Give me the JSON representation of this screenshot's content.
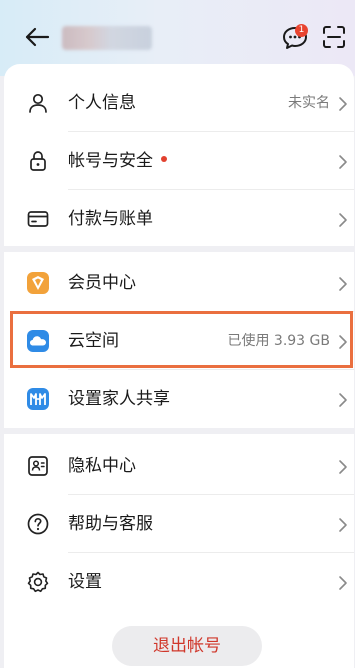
{
  "header": {
    "back_icon": "arrow-left-icon",
    "message_icon": "chat-bubble-icon",
    "message_badge": "1",
    "scan_icon": "scan-icon"
  },
  "groups": [
    {
      "items": [
        {
          "icon": "person-icon",
          "label": "个人信息",
          "value": "未实名"
        },
        {
          "icon": "lock-icon",
          "label": "帐号与安全",
          "value": "",
          "alert_dot": true
        },
        {
          "icon": "card-icon",
          "label": "付款与账单",
          "value": ""
        }
      ]
    },
    {
      "items": [
        {
          "icon": "member-shield-icon",
          "label": "会员中心",
          "value": ""
        },
        {
          "icon": "cloud-icon",
          "label": "云空间",
          "value": "已使用 3.93 GB"
        },
        {
          "icon": "family-share-icon",
          "label": "设置家人共享",
          "value": ""
        }
      ]
    },
    {
      "items": [
        {
          "icon": "privacy-icon",
          "label": "隐私中心",
          "value": ""
        },
        {
          "icon": "help-icon",
          "label": "帮助与客服",
          "value": ""
        },
        {
          "icon": "gear-icon",
          "label": "设置",
          "value": ""
        }
      ]
    }
  ],
  "logout_label": "退出帐号",
  "colors": {
    "accent_red": "#d0372b",
    "highlight": "#ea6f3f",
    "badge": "#e8432f"
  }
}
